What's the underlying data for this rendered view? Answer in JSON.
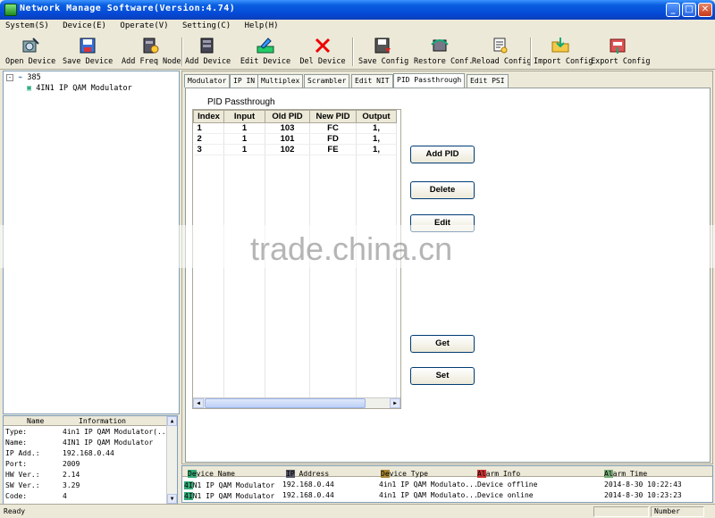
{
  "window": {
    "title": "Network Manage Software(Version:4.74)",
    "min": "_",
    "max": "□",
    "close": "✕"
  },
  "menu": [
    "System(S)",
    "Device(E)",
    "Operate(V)",
    "Setting(C)",
    "Help(H)"
  ],
  "toolbar": {
    "open_device": "Open Device",
    "save_device": "Save Device",
    "add_freq_node": "Add Freq Node",
    "add_device": "Add Device",
    "edit_device": "Edit Device",
    "del_device": "Del Device",
    "save_config": "Save Config",
    "restore_conf": "Restore Conf.",
    "reload_config": "Reload Config",
    "import_config": "Import Config",
    "export_config": "Export Config"
  },
  "tree": {
    "root": "385",
    "child": "4IN1 IP QAM Modulator"
  },
  "info": {
    "col_name": "Name",
    "col_info": "Information",
    "rows": [
      {
        "k": "Type:",
        "v": "4in1 IP QAM Modulator(..."
      },
      {
        "k": "Name:",
        "v": "4IN1 IP QAM Modulator"
      },
      {
        "k": "IP Add.:",
        "v": "192.168.0.44"
      },
      {
        "k": "Port:",
        "v": "2009"
      },
      {
        "k": "HW Ver.:",
        "v": "2.14"
      },
      {
        "k": "SW Ver.:",
        "v": "3.29"
      },
      {
        "k": "Code:",
        "v": "4"
      }
    ]
  },
  "tabs": [
    "Modulator",
    "IP IN",
    "Multiplex",
    "Scrambler",
    "Edit NIT",
    "PID Passthrough",
    "Edit PSI"
  ],
  "active_tab": "PID Passthrough",
  "passthrough": {
    "title": "PID Passthrough",
    "columns": [
      "Index",
      "Input",
      "Old PID",
      "New PID",
      "Output"
    ],
    "rows": [
      [
        "1",
        "1",
        "103",
        "FC",
        "1,"
      ],
      [
        "2",
        "1",
        "101",
        "FD",
        "1,"
      ],
      [
        "3",
        "1",
        "102",
        "FE",
        "1,"
      ]
    ],
    "buttons": {
      "add_pid": "Add PID",
      "delete": "Delete",
      "edit": "Edit",
      "get": "Get",
      "set": "Set"
    }
  },
  "alarm": {
    "columns": [
      "Device Name",
      "IP Address",
      "Device Type",
      "Alarm Info",
      "Alarm Time"
    ],
    "rows": [
      [
        "4IN1 IP QAM Modulator",
        "192.168.0.44",
        "4in1 IP QAM Modulato...",
        "Device offline",
        "2014-8-30 10:22:43"
      ],
      [
        "4IN1 IP QAM Modulator",
        "192.168.0.44",
        "4in1 IP QAM Modulato...",
        "Device online",
        "2014-8-30 10:23:23"
      ]
    ]
  },
  "status": {
    "left": "Ready",
    "right": "Number"
  },
  "watermark": "trade.china.cn"
}
